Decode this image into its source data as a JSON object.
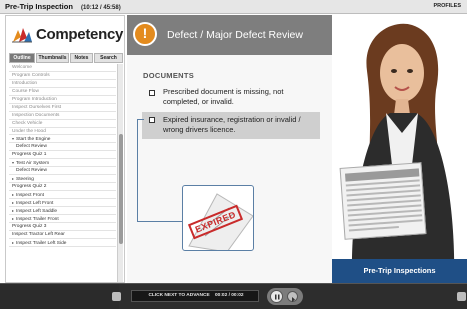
{
  "topbar": {
    "title": "Pre-Trip Inspection",
    "time": "(10:12 / 45:58)",
    "profile": "PROFILES"
  },
  "sidebar": {
    "logo_text": "CompetencyMill",
    "tabs": [
      "Outline",
      "Thumbnails",
      "Notes",
      "Search"
    ],
    "items": [
      {
        "label": "Welcome",
        "state": "dim"
      },
      {
        "label": "Program Controls",
        "state": "dim"
      },
      {
        "label": "Introduction",
        "state": "dim"
      },
      {
        "label": "Course Flow",
        "state": "dim"
      },
      {
        "label": "Program Introduction",
        "state": "dim"
      },
      {
        "label": "Inspect Ourselves First",
        "state": "dim"
      },
      {
        "label": "Inspection Documents",
        "state": "dim"
      },
      {
        "label": "Check Vehicle",
        "state": "dim"
      },
      {
        "label": "Under the Hood",
        "state": "dim"
      },
      {
        "label": "Start the Engine",
        "state": "expand"
      },
      {
        "label": "Defect Review",
        "state": "sub"
      },
      {
        "label": "Progress Quiz 1",
        "state": "normal"
      },
      {
        "label": "Test Air System",
        "state": "expand"
      },
      {
        "label": "Defect Review",
        "state": "sub"
      },
      {
        "label": "Steering",
        "state": "collapsed"
      },
      {
        "label": "Progress Quiz 2",
        "state": "normal"
      },
      {
        "label": "Inspect Front",
        "state": "collapsed"
      },
      {
        "label": "Inspect Left Front",
        "state": "collapsed"
      },
      {
        "label": "Inspect Left Saddle",
        "state": "collapsed"
      },
      {
        "label": "Inspect Trailer Front",
        "state": "collapsed"
      },
      {
        "label": "Progress Quiz 3",
        "state": "normal"
      },
      {
        "label": "Inspect Tractor Left Rear",
        "state": "normal"
      },
      {
        "label": "Inspect Trailer Left Side",
        "state": "collapsed"
      }
    ]
  },
  "content": {
    "header_title": "Defect / Major Defect Review",
    "section_label": "DOCUMENTS",
    "options": [
      {
        "line1": "Prescribed document is missing, not",
        "line2": "completed, or invalid."
      },
      {
        "line1": "Expired insurance, registration or invalid /",
        "line2": "wrong drivers licence."
      }
    ],
    "stamp": "EXPIRED",
    "footer_banner": "Pre-Trip Inspections"
  },
  "bottombar": {
    "advance_text": "CLICK NEXT TO ADVANCE",
    "counter": "00:02 / 00:02"
  },
  "colors": {
    "header_bg": "#7e7e7e",
    "warning": "#e38b1e",
    "banner": "#1f4f86",
    "stamp": "#c92b2b"
  }
}
